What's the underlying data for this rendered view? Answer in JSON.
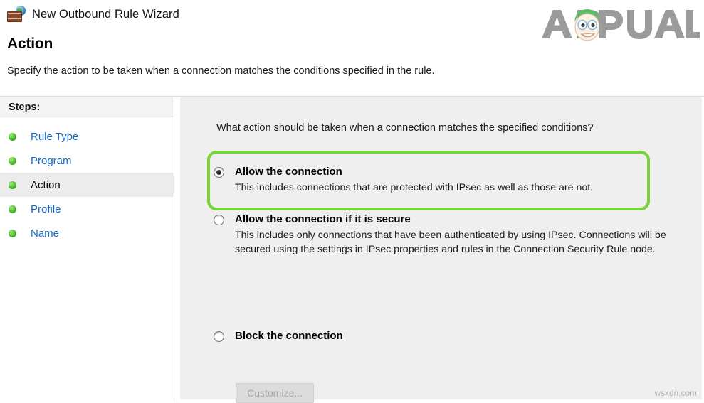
{
  "window": {
    "title": "New Outbound Rule Wizard",
    "icon": "firewall-globe-icon"
  },
  "brand": {
    "logo_text": "APPUALS",
    "logo_letters_before": "A",
    "logo_letters_after": "PUALS",
    "logo_color": "#9b9b9b",
    "hat_color": "#5bbf66"
  },
  "page": {
    "title": "Action",
    "subtitle": "Specify the action to be taken when a connection matches the conditions specified in the rule."
  },
  "sidebar": {
    "header": "Steps:",
    "items": [
      {
        "label": "Rule Type",
        "state": "completed"
      },
      {
        "label": "Program",
        "state": "completed"
      },
      {
        "label": "Action",
        "state": "current"
      },
      {
        "label": "Profile",
        "state": "completed"
      },
      {
        "label": "Name",
        "state": "completed"
      }
    ]
  },
  "main": {
    "question": "What action should be taken when a connection matches the specified conditions?",
    "options": [
      {
        "label": "Allow the connection",
        "description": "This includes connections that are protected with IPsec as well as those are not.",
        "selected": true
      },
      {
        "label": "Allow the connection if it is secure",
        "description": "This includes only connections that have been authenticated by using IPsec.  Connections will be secured using the settings in IPsec properties and rules in the Connection Security Rule node.",
        "selected": false
      },
      {
        "label": "Block the connection",
        "description": "",
        "selected": false
      }
    ],
    "customize_button": {
      "label": "Customize...",
      "enabled": false
    },
    "highlight_color": "#77d337"
  },
  "watermark": "wsxdn.com"
}
